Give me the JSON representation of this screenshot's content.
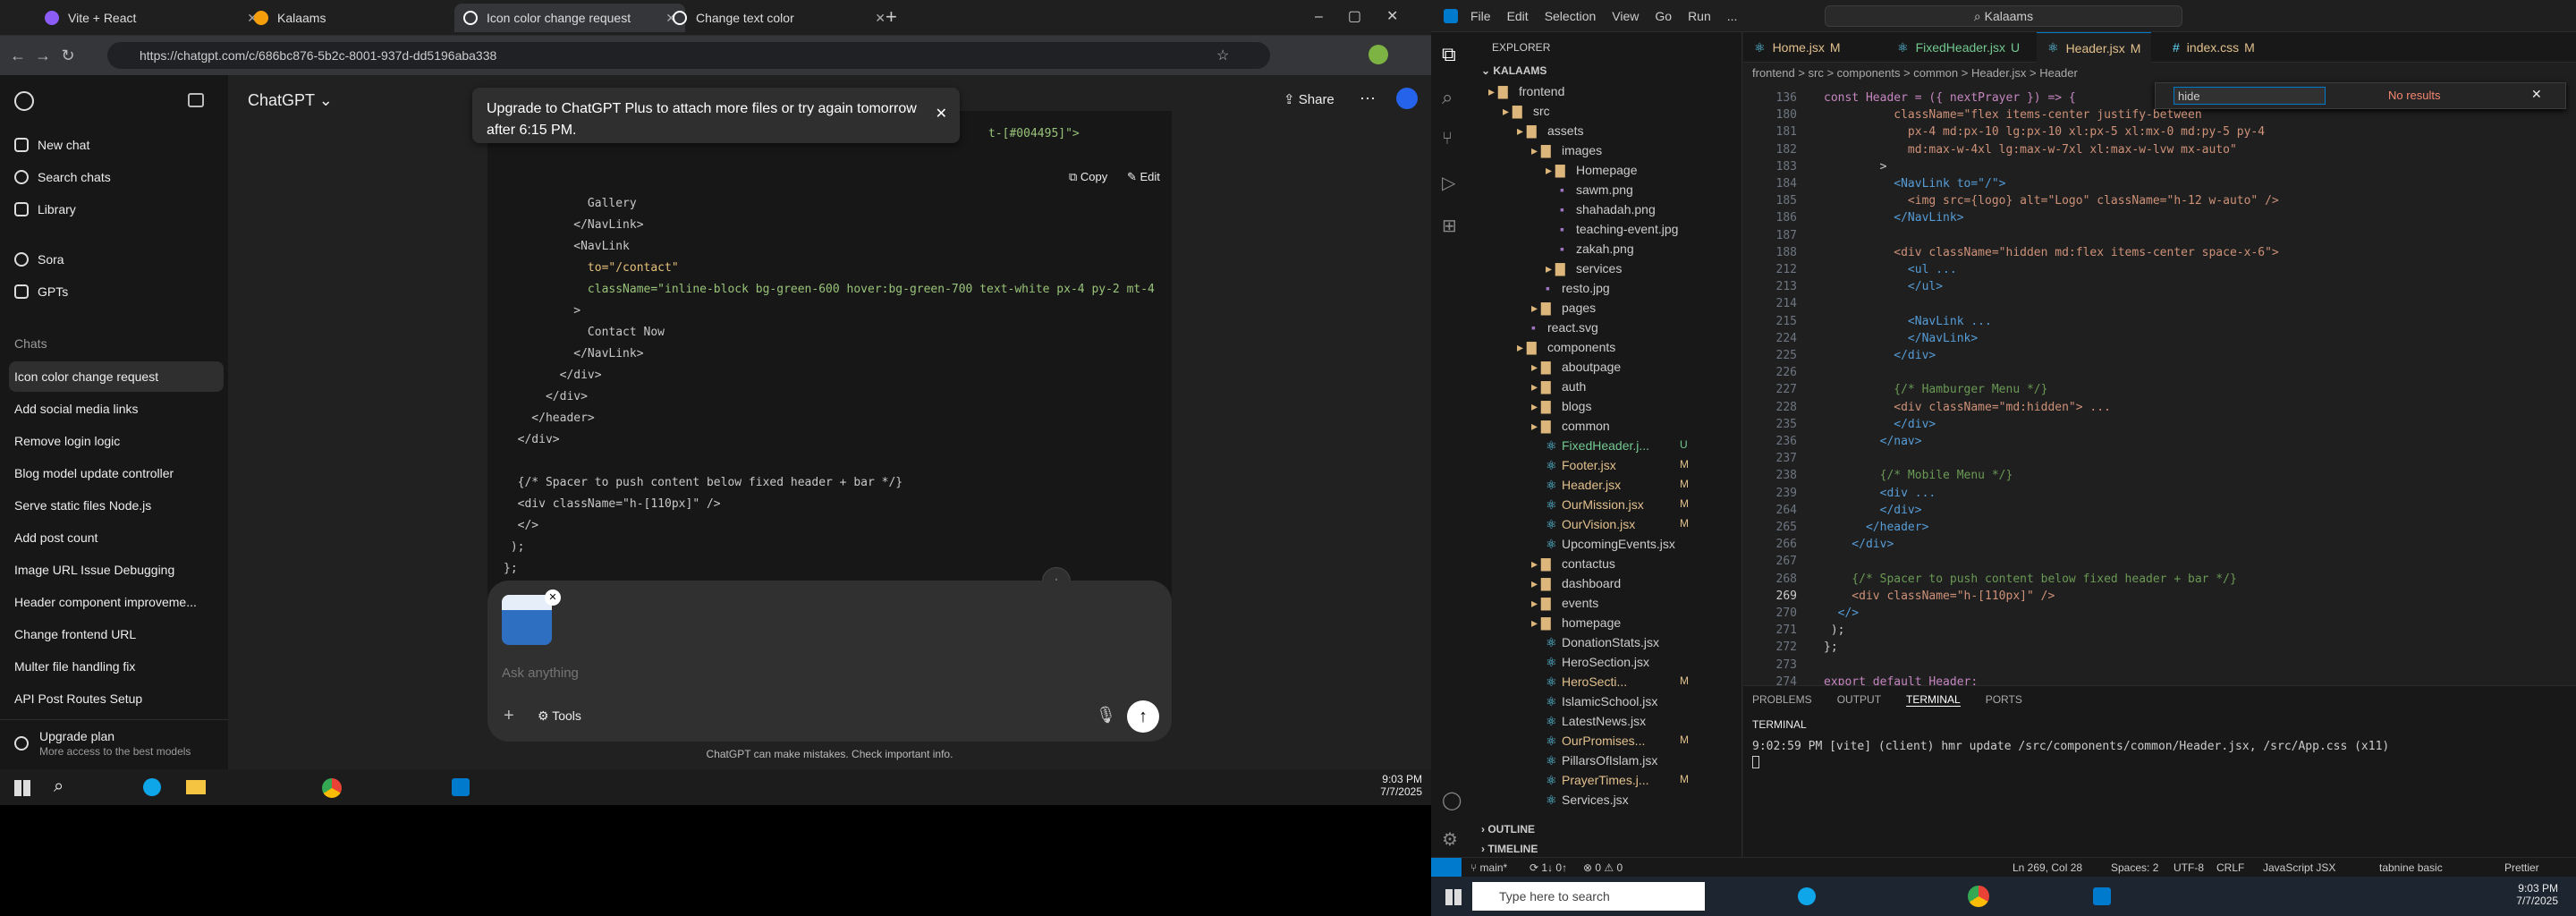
{
  "browser": {
    "tabs": [
      {
        "title": "Vite + React",
        "color": "#8b5cf6"
      },
      {
        "title": "Kalaams",
        "color": "#f59e0b"
      },
      {
        "title": "Icon color change request",
        "color": "#ffffff"
      },
      {
        "title": "Change text color",
        "color": "#ffffff"
      }
    ],
    "url": "https://chatgpt.com/c/686bc876-5b2c-8001-937d-dd5196aba338"
  },
  "chatgpt": {
    "model": "ChatGPT",
    "share": "Share",
    "sidebar": {
      "new_chat": "New chat",
      "search": "Search chats",
      "library": "Library",
      "sora": "Sora",
      "gpts": "GPTs",
      "section": "Chats",
      "chats": [
        "Icon color change request",
        "Add social media links",
        "Remove login logic",
        "Blog model update controller",
        "Serve static files Node.js",
        "Add post count",
        "Image URL Issue Debugging",
        "Header component improveme...",
        "Change frontend URL",
        "Multer file handling fix",
        "API Post Routes Setup"
      ],
      "upgrade": "Upgrade plan",
      "upgrade_sub": "More access to the best models"
    },
    "toast": "Upgrade to ChatGPT Plus to attach more files or try again tomorrow after 6:15 PM.",
    "code_actions": {
      "copy": "Copy",
      "edit": "Edit"
    },
    "code_header": "t-[#004495]\">",
    "code_lines": [
      [
        "            Gallery",
        ""
      ],
      [
        "          </NavLink>",
        ""
      ],
      [
        "          <NavLink",
        ""
      ],
      [
        "            to=\"/contact\"",
        "at"
      ],
      [
        "            className=\"inline-block bg-green-600 hover:bg-green-700 text-white px-4 py-2 mt-4",
        "str"
      ],
      [
        "          >",
        ""
      ],
      [
        "            Contact Now",
        ""
      ],
      [
        "          </NavLink>",
        ""
      ],
      [
        "        </div>",
        ""
      ],
      [
        "      </div>",
        ""
      ],
      [
        "    </header>",
        ""
      ],
      [
        "  </div>",
        ""
      ],
      [
        "",
        ""
      ],
      [
        "  {/* Spacer to push content below fixed header + bar */}",
        ""
      ],
      [
        "  <div className=\"h-[110px]\" />",
        ""
      ],
      [
        "  </>",
        ""
      ],
      [
        " );",
        ""
      ],
      [
        "};",
        ""
      ],
      [
        "",
        ""
      ],
      [
        "export default Header;",
        "kw"
      ]
    ],
    "placeholder": "Ask anything",
    "tools": "Tools",
    "disclaimer": "ChatGPT can make mistakes. Check important info."
  },
  "taskbar_left": {
    "time": "9:03 PM",
    "date": "7/7/2025"
  },
  "vscode": {
    "title": "Kalaams",
    "menu": [
      "File",
      "Edit",
      "Selection",
      "View",
      "Go",
      "Run",
      "..."
    ],
    "explorer_title": "EXPLORER",
    "project": "KALAAMS",
    "tree": [
      [
        "frontend",
        1,
        "folder",
        ""
      ],
      [
        "src",
        2,
        "folder",
        ""
      ],
      [
        "assets",
        3,
        "folder",
        ""
      ],
      [
        "images",
        4,
        "folder",
        ""
      ],
      [
        "Homepage",
        5,
        "folder",
        ""
      ],
      [
        "sawm.png",
        6,
        "img",
        ""
      ],
      [
        "shahadah.png",
        6,
        "img",
        ""
      ],
      [
        "teaching-event.jpg",
        6,
        "img",
        ""
      ],
      [
        "zakah.png",
        6,
        "img",
        ""
      ],
      [
        "services",
        5,
        "folder",
        ""
      ],
      [
        "resto.jpg",
        5,
        "img",
        ""
      ],
      [
        "pages",
        4,
        "folder",
        ""
      ],
      [
        "react.svg",
        4,
        "img",
        ""
      ],
      [
        "components",
        3,
        "folder",
        ""
      ],
      [
        "aboutpage",
        4,
        "folder",
        ""
      ],
      [
        "auth",
        4,
        "folder",
        ""
      ],
      [
        "blogs",
        4,
        "folder",
        ""
      ],
      [
        "common",
        4,
        "folder",
        ""
      ],
      [
        "FixedHeader.j...",
        5,
        "jsx",
        "U"
      ],
      [
        "Footer.jsx",
        5,
        "jsx",
        "M"
      ],
      [
        "Header.jsx",
        5,
        "jsx",
        "M"
      ],
      [
        "OurMission.jsx",
        5,
        "jsx",
        "M"
      ],
      [
        "OurVision.jsx",
        5,
        "jsx",
        "M"
      ],
      [
        "UpcomingEvents.jsx",
        5,
        "jsx",
        ""
      ],
      [
        "contactus",
        4,
        "folder",
        ""
      ],
      [
        "dashboard",
        4,
        "folder",
        ""
      ],
      [
        "events",
        4,
        "folder",
        ""
      ],
      [
        "homepage",
        4,
        "folder",
        ""
      ],
      [
        "DonationStats.jsx",
        5,
        "jsx",
        ""
      ],
      [
        "HeroSection.jsx",
        5,
        "jsx",
        ""
      ],
      [
        "HeroSecti...",
        5,
        "jsx",
        "M"
      ],
      [
        "IslamicSchool.jsx",
        5,
        "jsx",
        ""
      ],
      [
        "LatestNews.jsx",
        5,
        "jsx",
        ""
      ],
      [
        "OurPromises...",
        5,
        "jsx",
        "M"
      ],
      [
        "PillarsOfIslam.jsx",
        5,
        "jsx",
        ""
      ],
      [
        "PrayerTimes.j...",
        5,
        "jsx",
        "M"
      ],
      [
        "Services.jsx",
        5,
        "jsx",
        ""
      ]
    ],
    "outline": "OUTLINE",
    "timeline": "TIMELINE",
    "tabs": [
      [
        "Home.jsx",
        "M"
      ],
      [
        "FixedHeader.jsx",
        "U"
      ],
      [
        "Header.jsx",
        "M"
      ],
      [
        "index.css",
        "M"
      ]
    ],
    "breadcrumb": "frontend > src > components > common > Header.jsx > Header",
    "find": {
      "query": "hide",
      "result": "No results"
    },
    "lines": [
      [
        "136",
        "const Header = ({ nextPrayer }) => {"
      ],
      [
        "180",
        "          className=\"flex items-center justify-between"
      ],
      [
        "181",
        "            px-4 md:px-10 lg:px-10 xl:px-5 xl:mx-0 md:py-5 py-4"
      ],
      [
        "182",
        "            md:max-w-4xl lg:max-w-7xl xl:max-w-lvw mx-auto\""
      ],
      [
        "183",
        "        >"
      ],
      [
        "184",
        "          <NavLink to=\"/\">"
      ],
      [
        "185",
        "            <img src={logo} alt=\"Logo\" className=\"h-12 w-auto\" />"
      ],
      [
        "186",
        "          </NavLink>"
      ],
      [
        "187",
        ""
      ],
      [
        "188",
        "          <div className=\"hidden md:flex items-center space-x-6\">"
      ],
      [
        "212",
        "            <ul ..."
      ],
      [
        "213",
        "            </ul>"
      ],
      [
        "214",
        ""
      ],
      [
        "215",
        "            <NavLink ..."
      ],
      [
        "224",
        "            </NavLink>"
      ],
      [
        "225",
        "          </div>"
      ],
      [
        "226",
        ""
      ],
      [
        "227",
        "          {/* Hamburger Menu */}"
      ],
      [
        "228",
        "          <div className=\"md:hidden\"> ..."
      ],
      [
        "235",
        "          </div>"
      ],
      [
        "236",
        "        </nav>"
      ],
      [
        "237",
        ""
      ],
      [
        "238",
        "        {/* Mobile Menu */}"
      ],
      [
        "239",
        "        <div ..."
      ],
      [
        "264",
        "        </div>"
      ],
      [
        "265",
        "      </header>"
      ],
      [
        "266",
        "    </div>"
      ],
      [
        "267",
        ""
      ],
      [
        "268",
        "    {/* Spacer to push content below fixed header + bar */}"
      ],
      [
        "269",
        "    <div className=\"h-[110px]\" />"
      ],
      [
        "270",
        "  </>"
      ],
      [
        "271",
        " );"
      ],
      [
        "272",
        "};"
      ],
      [
        "273",
        ""
      ],
      [
        "274",
        "export default Header;"
      ]
    ],
    "panel_tabs": [
      "PROBLEMS",
      "OUTPUT",
      "TERMINAL",
      "PORTS"
    ],
    "terminal_title": "TERMINAL",
    "terminal_line": "9:02:59 PM [vite] (client) hmr update /src/components/common/Header.jsx, /src/App.css (x11)",
    "status": {
      "branch": "main*",
      "sync": "⟳ 1↓ 0↑",
      "errors": "⊗ 0 ⚠ 0",
      "pos": "Ln 269, Col 28",
      "spaces": "Spaces: 2",
      "enc": "UTF-8",
      "eol": "CRLF",
      "lang": "JavaScript JSX",
      "tabnine": "tabnine basic",
      "prettier": "Prettier"
    }
  },
  "taskbar_right": {
    "search": "Type here to search",
    "time": "9:03 PM",
    "date": "7/7/2025"
  }
}
